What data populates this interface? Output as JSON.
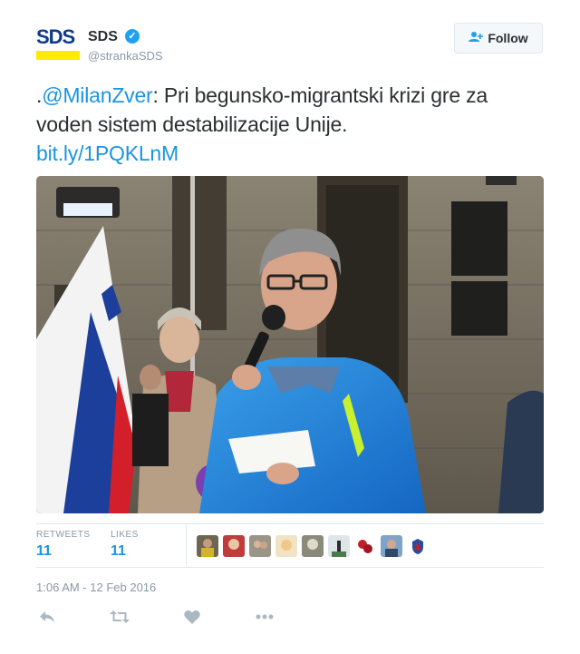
{
  "account": {
    "logo_text": "SDS",
    "name": "SDS",
    "handle": "@strankaSDS",
    "verified_icon": "verified-badge-icon"
  },
  "follow": {
    "label": "Follow",
    "icon": "add-user-icon"
  },
  "tweet": {
    "prefix": ".",
    "mention": "@MilanZver",
    "text": ": Pri begunsko-migrantski krizi gre za voden sistem destabilizacije Unije.",
    "link": "bit.ly/1PQKLnM"
  },
  "photo": {
    "description_icon": "photo"
  },
  "stats": {
    "retweets_label": "RETWEETS",
    "retweets_value": "11",
    "likes_label": "LIKES",
    "likes_value": "11"
  },
  "timestamp": "1:06 AM - 12 Feb 2016",
  "actions": [
    "reply-icon",
    "retweet-icon",
    "like-icon",
    "more-icon"
  ],
  "colors": {
    "link": "#1b95e0",
    "verified": "#1da1f2",
    "logo_blue": "#0e3a8a",
    "logo_yellow": "#ffeb00"
  }
}
